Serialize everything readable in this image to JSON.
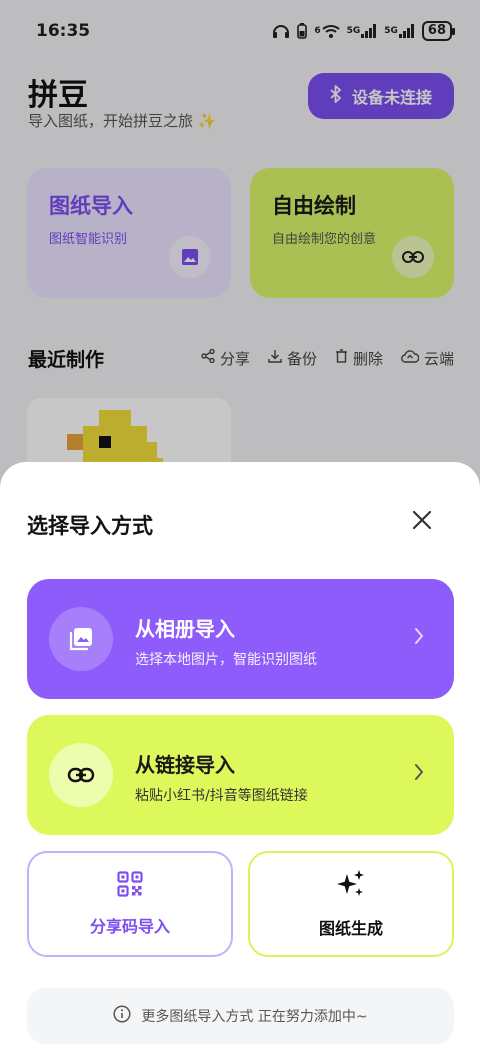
{
  "status_bar": {
    "time": "16:35",
    "battery": "68",
    "network_1": "5G",
    "network_2": "5G",
    "wifi_label": "6"
  },
  "header": {
    "title": "拼豆",
    "subtitle": "导入图纸，开始拼豆之旅 ✨",
    "device_button": "设备未连接"
  },
  "cards": {
    "import": {
      "title": "图纸导入",
      "subtitle": "图纸智能识别"
    },
    "draw": {
      "title": "自由绘制",
      "subtitle": "自由绘制您的创意"
    }
  },
  "recent": {
    "title": "最近制作",
    "actions": [
      "分享",
      "备份",
      "删除",
      "云端"
    ]
  },
  "sheet": {
    "title": "选择导入方式",
    "album_option": {
      "title": "从相册导入",
      "subtitle": "选择本地图片，智能识别图纸"
    },
    "link_option": {
      "title": "从链接导入",
      "subtitle": "粘贴小红书/抖音等图纸链接"
    },
    "share_code": "分享码导入",
    "generate": "图纸生成",
    "info": "更多图纸导入方式 正在努力添加中~"
  },
  "colors": {
    "purple": "#8e5cfa",
    "lime": "#dcf85a",
    "accent": "#7c4ff0"
  }
}
